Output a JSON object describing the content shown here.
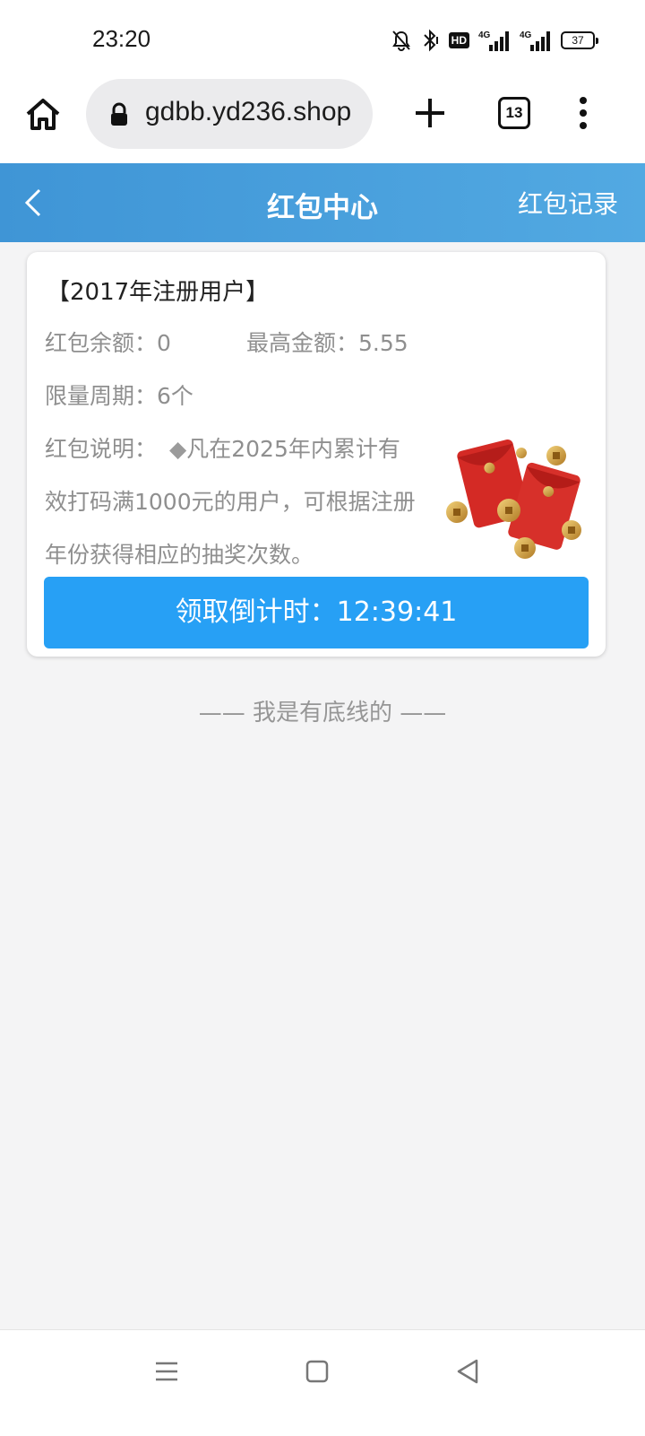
{
  "status_bar": {
    "time": "23:20",
    "icons": [
      "bell-muted-icon",
      "bluetooth-icon",
      "hd-icon",
      "signal-4g-icon",
      "signal-4g-icon",
      "battery-icon"
    ],
    "hd_label": "HD",
    "battery": "37"
  },
  "browser": {
    "url": "gdbb.yd236.shop",
    "tab_count": "13"
  },
  "header": {
    "title": "红包中心",
    "right_link": "红包记录"
  },
  "card": {
    "title": "【2017年注册用户】",
    "balance_label": "红包余额：",
    "balance_value": "0",
    "max_label": "最高金额：",
    "max_value": "5.55",
    "period_label": "限量周期：",
    "period_value": "6个",
    "desc_label": "红包说明：",
    "desc_bullet": "◆",
    "desc_line1": "凡在2025年内累计有",
    "desc_line2": "效打码满1000元的用户，可根据注册",
    "desc_line3": "年份获得相应的抽奖次数。",
    "button_label": "领取倒计时：",
    "countdown": "12:39:41"
  },
  "footer_note": "—— 我是有底线的 ——",
  "colors": {
    "header_bg": "#4aa3de",
    "button_bg": "#27a0f5",
    "page_bg": "#f4f4f5"
  }
}
